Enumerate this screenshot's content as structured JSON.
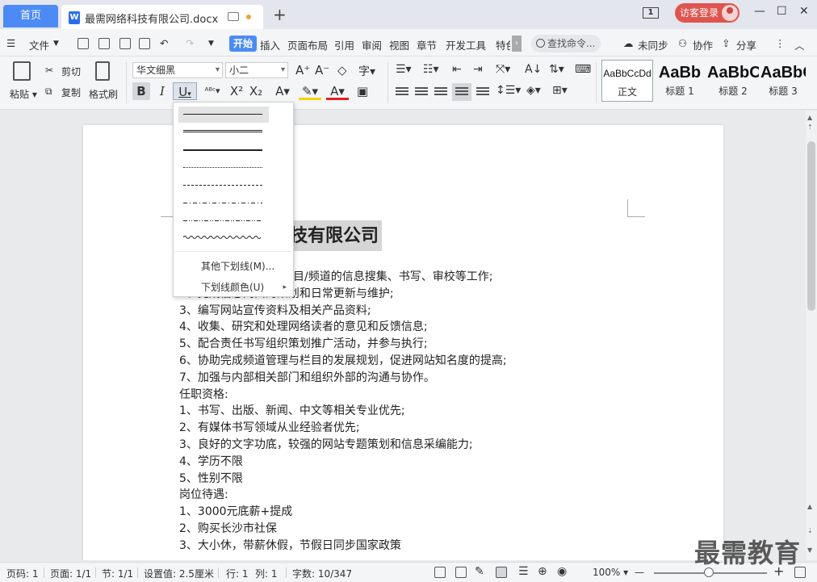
{
  "tabs": {
    "home": "首页",
    "doc": "最需网络科技有限公司.docx",
    "add": "+"
  },
  "titlebar": {
    "page_badge": "1",
    "visitor": "访客登录",
    "min": "—",
    "max": "☐",
    "close": "✕"
  },
  "menubar": {
    "file": "文件",
    "items": [
      "开始",
      "插入",
      "页面布局",
      "引用",
      "审阅",
      "视图",
      "章节",
      "开发工具",
      "特色"
    ],
    "search": "查找命令...",
    "unsync": "未同步",
    "collab": "协作",
    "share": "分享"
  },
  "ribbon": {
    "paste": "粘贴",
    "cut": "剪切",
    "copy": "复制",
    "format_painter": "格式刷",
    "font_name": "华文细黑",
    "font_size": "小二",
    "bold": "B",
    "italic": "I",
    "underline": "U",
    "styles": [
      {
        "sample": "AaBbCcDd",
        "name": "正文"
      },
      {
        "sample": "AaBb",
        "name": "标题 1"
      },
      {
        "sample": "AaBbC",
        "name": "标题 2"
      },
      {
        "sample": "AaBbC",
        "name": "标题 3"
      }
    ]
  },
  "underline_menu": {
    "more": "其他下划线(M)...",
    "color": "下划线颜色(U)"
  },
  "document": {
    "heading_visible": "技有限公司",
    "lines": [
      "目/频道的信息搜集、书写、审校等工作;",
      "2、完成信息网由的策划和日常更新与维护;",
      "3、编写网站宣传资料及相关产品资料;",
      "4、收集、研究和处理网络读者的意见和反馈信息;",
      "5、配合责任书写组织策划推广活动，并参与执行;",
      "6、协助完成频道管理与栏目的发展规划，促进网站知名度的提高;",
      "7、加强与内部相关部门和组织外部的沟通与协作。",
      "任职资格:",
      "1、书写、出版、新闻、中文等相关专业优先;",
      "2、有媒体书写领域从业经验者优先;",
      "3、良好的文字功底，较强的网站专题策划和信息采编能力;",
      "4、学历不限",
      "5、性别不限",
      "岗位待遇:",
      "1、3000元底薪+提成",
      "2、购买长沙市社保",
      "3、大小休，带薪休假，节假日同步国家政策"
    ]
  },
  "statusbar": {
    "page_no": "页码: 1",
    "pages": "页面: 1/1",
    "section": "节: 1/1",
    "setting": "设置值: 2.5厘米",
    "row": "行: 1",
    "col": "列: 1",
    "words": "字数: 10/347",
    "zoom": "100%",
    "minus": "—",
    "plus": "+"
  },
  "watermark": "最需教育",
  "colors": {
    "accent": "#4c8bf5",
    "visitor": "#e0544f"
  }
}
